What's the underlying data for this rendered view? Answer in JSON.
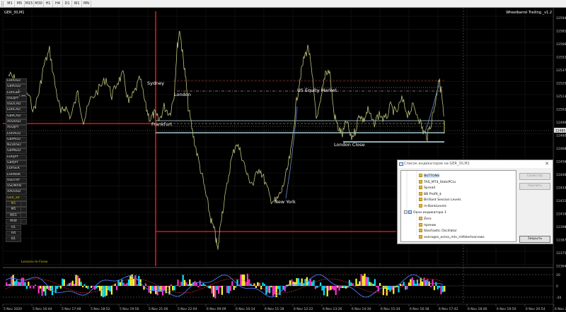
{
  "toolbar": {
    "timeframes": [
      "M1",
      "M5",
      "M15",
      "M30",
      "H1",
      "H4",
      "D1",
      "W1",
      "MN"
    ]
  },
  "chart": {
    "symbol_label": "GER_30,M1",
    "ea_label": "Wheelbarrel Trailing _v1.2",
    "bottom_label": "Lessons-In-Forex",
    "session_labels": [
      "Sydney",
      "London",
      "US Equity Market",
      "Frankfurt",
      "London Close",
      "New York"
    ],
    "price_axis": [
      "12594",
      "12581",
      "12566",
      "12552",
      "12537",
      "12525",
      "12513",
      "12502",
      "12490",
      "12480",
      "12468",
      "12456",
      "12446",
      "12433",
      "12421",
      "12410",
      "12398",
      "12387",
      "12375",
      "12364"
    ],
    "current_price": "12485",
    "osc_axis": [
      "20",
      "0",
      "-20"
    ],
    "time_axis": [
      "5 Nov 2020",
      "5 Nov 16:44",
      "5 Nov 17:48",
      "5 Nov 18:52",
      "5 Nov 19:56",
      "5 Nov 21:00",
      "5 Nov 22:04",
      "6 Nov 09:09",
      "6 Nov 10:14",
      "6 Nov 11:18",
      "6 Nov 12:22",
      "6 Nov 13:26",
      "6 Nov 14:30",
      "6 Nov 15:34",
      "6 Nov 16:38",
      "6 Nov 17:42",
      "6 Nov 18:46",
      "6 Nov 19:50",
      "6 Nov 20:54",
      "6 Nov 21:59"
    ],
    "colors": {
      "price_line": "#bcc07a",
      "price_line_alt": "#6f8fc8",
      "session_red": "#ff1a1a",
      "level_cyan": "#bfe8f0",
      "text": "#ffffff"
    }
  },
  "symbols": [
    "EURUSD",
    "GBPUSD",
    "EURGBP",
    "USDJPY",
    "USDCAD",
    "EURCAD",
    "GBPCAD",
    "AUDUSD",
    "AUDJPY",
    "EURAUD",
    "GBPAUD",
    "NZDUSD",
    "GBPNZD",
    "EURJPY",
    "GBPJPY",
    "EURSEK",
    "EURNOK",
    "USDTRY",
    "USDMXN",
    "XAUUSD",
    "GER_30",
    "HKG_50",
    "US30",
    "USOIL",
    "NDAQ"
  ],
  "active_symbol": "GER_30",
  "timeframe_buttons": [
    "M1",
    "M5",
    "M15",
    "M30",
    "H1",
    "H4",
    "D1"
  ],
  "dialog": {
    "title": "Список индикаторов на GER_30,M1",
    "close_glyph": "✕",
    "items": [
      "BUTTONS",
      "TAS_MT4_StatsPCLs",
      "Spread",
      "BB Profit_$",
      "Brilliant Session Levels",
      "m-BankLevels"
    ],
    "window_label": "Окно индикатора 1",
    "sub_items": [
      "Zero",
      "пряник",
      "Stochastic Oscillator",
      "averages_osma_mtc_mtfalertsarrows"
    ],
    "btn_props": "Свойства",
    "btn_delete": "Удалить",
    "btn_close": "Закрыть"
  }
}
